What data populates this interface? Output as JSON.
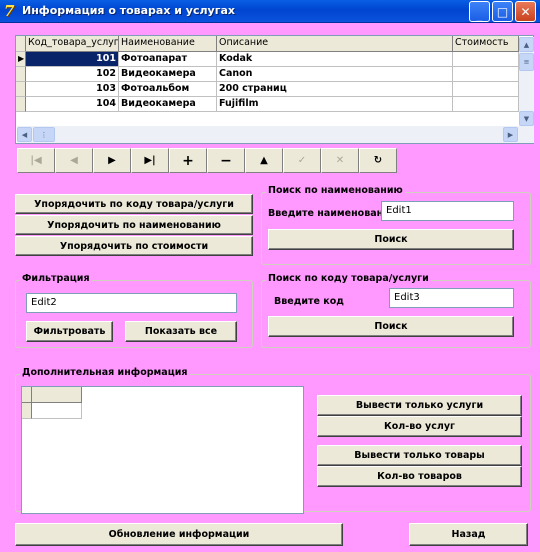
{
  "window": {
    "title": "Информация о товарах и услугах"
  },
  "grid": {
    "columns": [
      "Код_товара_услуги",
      "Наименование",
      "Описание",
      "Стоимость"
    ],
    "rows": [
      {
        "id": "101",
        "name": "Фотоапарат",
        "desc": "Kodak",
        "price": ""
      },
      {
        "id": "102",
        "name": "Видеокамера",
        "desc": "Canon",
        "price": ""
      },
      {
        "id": "103",
        "name": "Фотоальбом",
        "desc": "200 страниц",
        "price": ""
      },
      {
        "id": "104",
        "name": "Видеокамера",
        "desc": "Fujifilm",
        "price": ""
      }
    ]
  },
  "navigator": [
    "first-icon",
    "prior-icon",
    "next-icon",
    "last-icon",
    "insert-icon",
    "delete-icon",
    "edit-icon",
    "post-icon",
    "cancel-icon",
    "refresh-icon"
  ],
  "sort": {
    "by_code": "Упорядочить по коду товара/услуги",
    "by_name": "Упорядочить по наименованию",
    "by_price": "Упорядочить по стоимости"
  },
  "search_name": {
    "group": "Поиск по наименованию",
    "label": "Введите наименование",
    "value": "Edit1",
    "button": "Поиск"
  },
  "filter": {
    "group": "Фильтрация",
    "value": "Edit2",
    "apply": "Фильтровать",
    "show_all": "Показать все"
  },
  "search_code": {
    "group": "Поиск по коду товара/услуги",
    "label": "Введите код",
    "value": "Edit3",
    "button": "Поиск"
  },
  "extra": {
    "group": "Дополнительная информация",
    "services_only": "Вывести только услуги",
    "services_count": "Кол-во услуг",
    "goods_only": "Вывести только товары",
    "goods_count": "Кол-во товаров"
  },
  "bottom": {
    "refresh": "Обновление информации",
    "back": "Назад"
  }
}
